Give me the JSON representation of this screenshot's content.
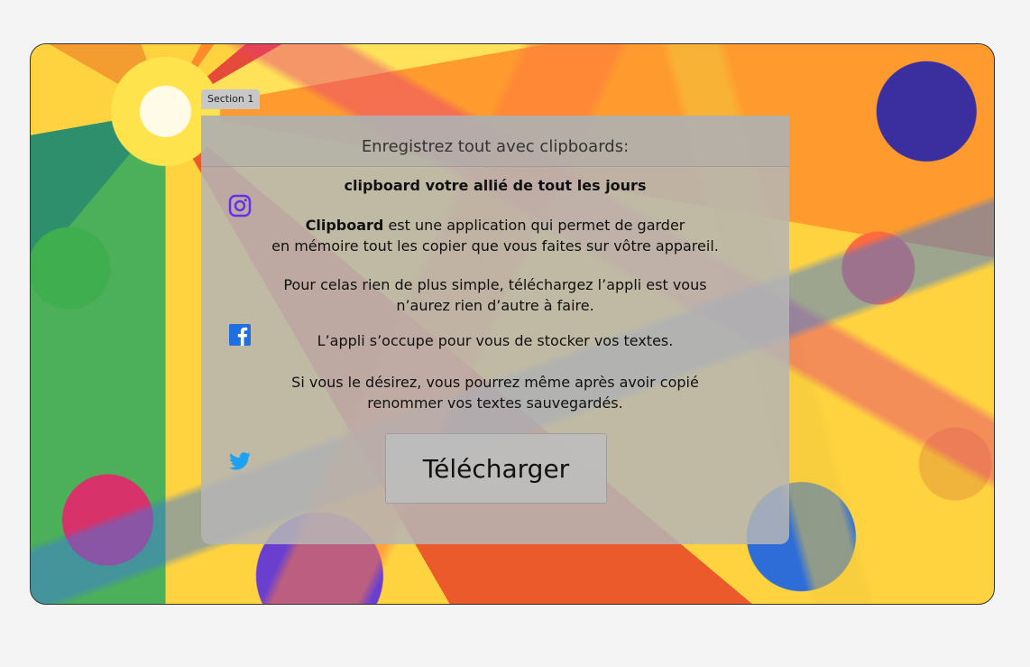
{
  "section_tag": "Section 1",
  "header": {
    "title": "Enregistrez tout avec clipboards:"
  },
  "content": {
    "subtitle": "clipboard votre allié de tout les jours",
    "p1_strong": "Clipboard",
    "p1_rest": " est une application qui permet de garder",
    "p1_line2": "en mémoire tout les copier que vous faites sur vôtre appareil.",
    "p2_line1": "Pour celas rien de plus simple, téléchargez l’appli est vous",
    "p2_line2": "n’aurez rien d’autre à faire.",
    "p3": "L’appli s’occupe pour vous de stocker vos textes.",
    "p4_line1": "Si vous le désirez, vous pourrez même après avoir copié",
    "p4_line2": "renommer vos textes sauvegardés."
  },
  "download_button": "Télécharger",
  "social": [
    "instagram-icon",
    "facebook-icon",
    "twitter-icon"
  ],
  "colors": {
    "instagram": "#6a2ef0",
    "facebook": "#1f6fe0",
    "twitter": "#1da1f2"
  }
}
